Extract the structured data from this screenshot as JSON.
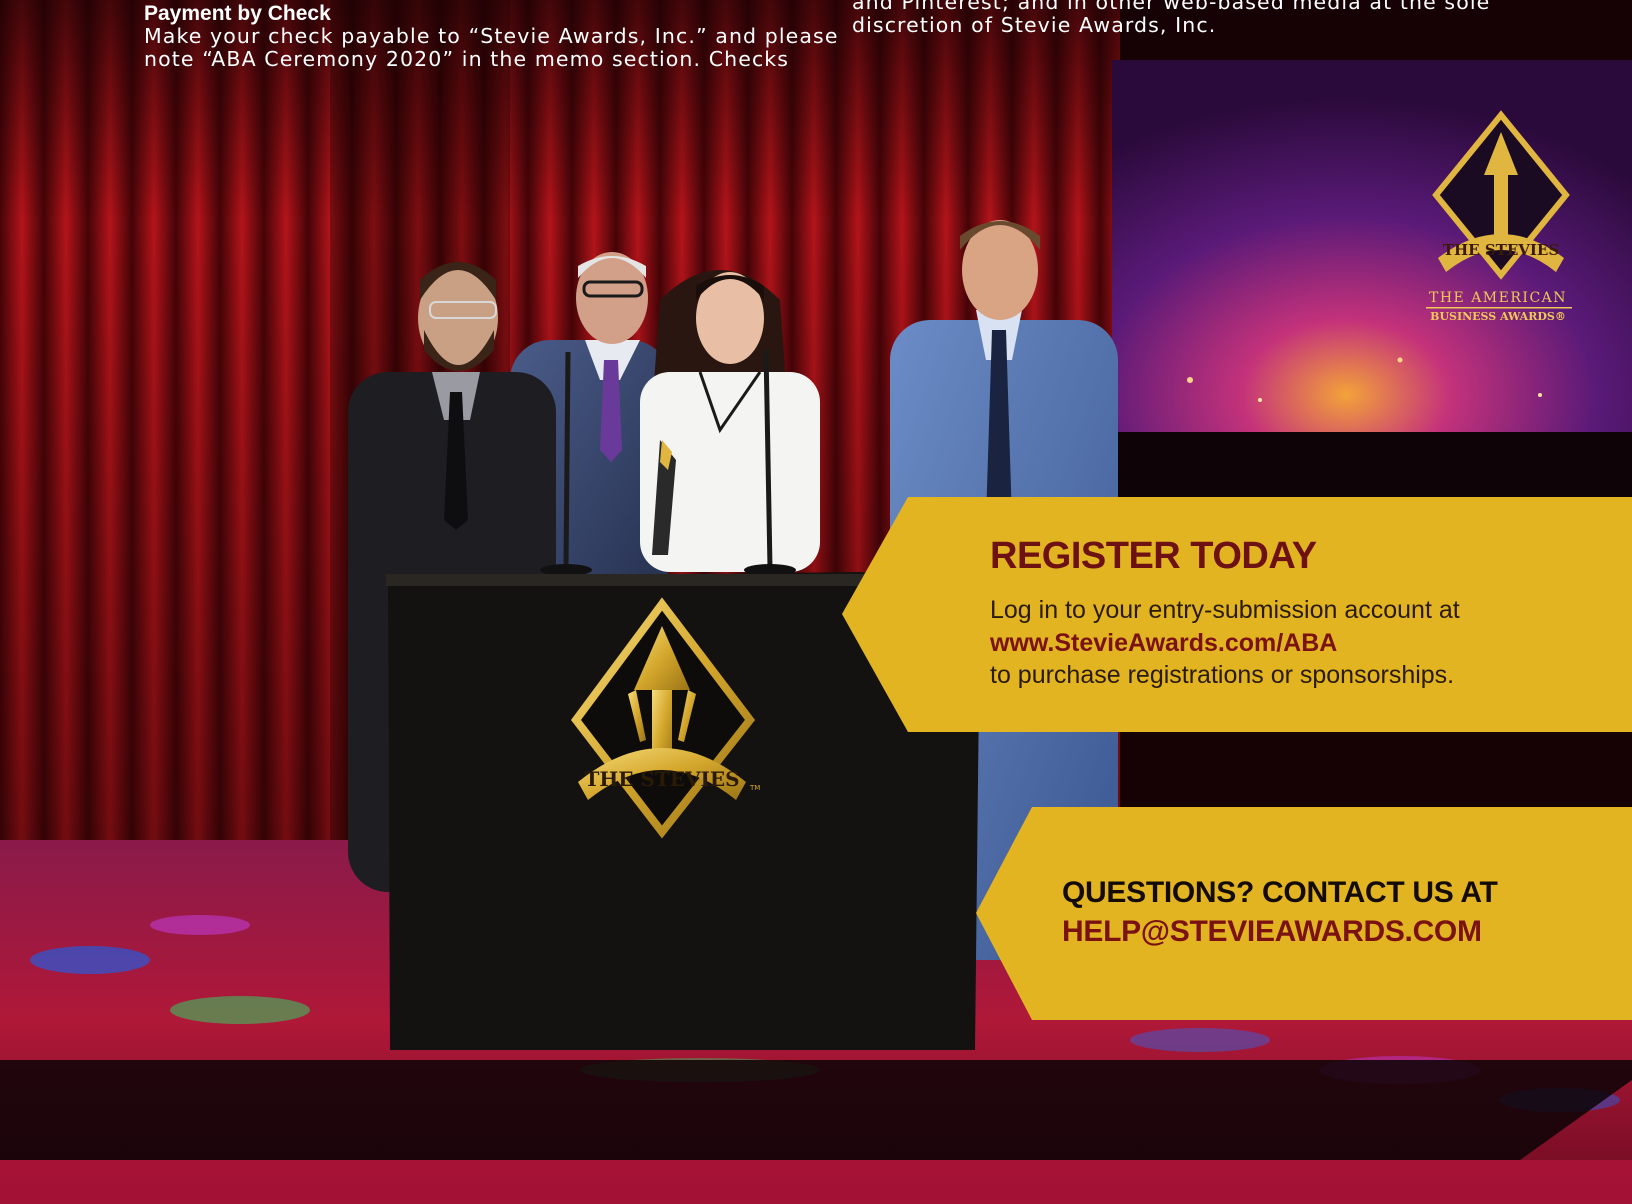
{
  "colors": {
    "panel_gold": "#e2b421",
    "title_maroon": "#6e1113",
    "curtain_red": "#9c0f17",
    "screen_purple": "#6a1a6e"
  },
  "top_left": {
    "heading": "Payment by Check",
    "lines": [
      "Make your check payable to “Stevie Awards, Inc.” and please",
      "note “ABA Ceremony 2020” in the memo section. Checks"
    ]
  },
  "top_right": {
    "lines": [
      "and Pinterest; and in other web-based media at the sole",
      "discretion of Stevie Awards, Inc."
    ]
  },
  "screen": {
    "logo_text": "THE STEVIES",
    "line1": "THE AMERICAN",
    "line2": "BUSINESS AWARDS®"
  },
  "podium": {
    "logo_text": "THE STEVIES",
    "tm": "TM"
  },
  "register": {
    "title": "REGISTER TODAY",
    "line1": "Log in to your entry-submission account at",
    "url": "www.StevieAwards.com/ABA",
    "line3": "to purchase registrations or sponsorships."
  },
  "contact": {
    "line1": "QUESTIONS? CONTACT US AT",
    "email": "HELP@STEVIEAWARDS.COM"
  }
}
